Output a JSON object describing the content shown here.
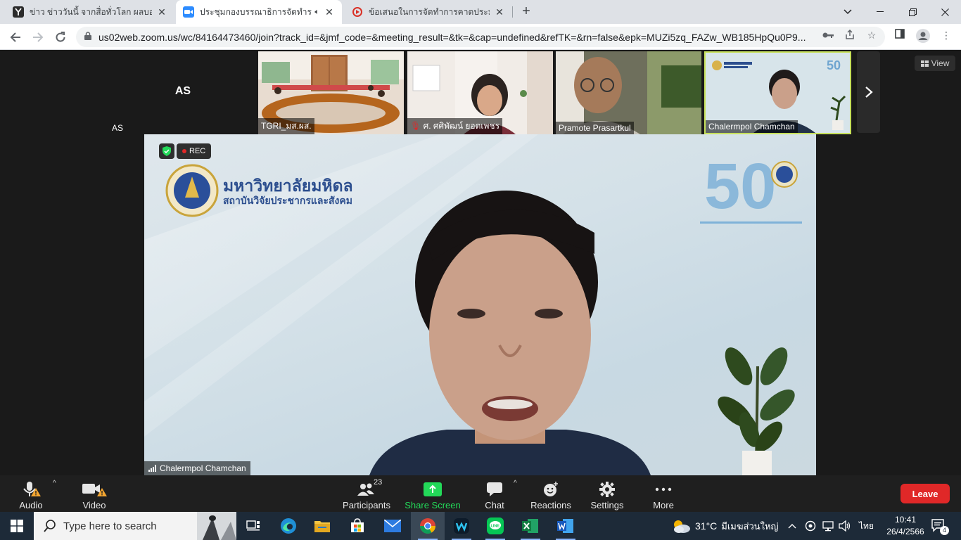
{
  "browser": {
    "tabs": [
      {
        "title": "ข่าว ข่าววันนี้ จากสื่อทั่วโลก ผลบอลโลก",
        "active": false
      },
      {
        "title": "ประชุมกองบรรณาธิการจัดทำราย",
        "active": true,
        "audio": true
      },
      {
        "title": "ข้อเสนอในการจัดทำการคาดประมาณป",
        "active": false
      }
    ],
    "url": "us02web.zoom.us/wc/84164473460/join?track_id=&jmf_code=&meeting_result=&tk=&cap=undefined&refTK=&rn=false&epk=MUZi5zq_FAZw_WB185HpQu0P9..."
  },
  "zoom": {
    "view_label": "View",
    "participants_strip": [
      {
        "name": "AS",
        "initials": "AS",
        "video": false
      },
      {
        "name": "TGRI_มส.ผส.",
        "video": true
      },
      {
        "name": "ศ. ศศิพัฒน์ ยอดเพชร",
        "video": true,
        "muted": true
      },
      {
        "name": "Pramote Prasartkul",
        "video": true
      },
      {
        "name": "Chalermpol Chamchan",
        "video": true,
        "speaking": true
      }
    ],
    "main_speaker": {
      "name": "Chalermpol Chamchan",
      "rec_label": "REC",
      "background_text": {
        "university": "มหาวิทยาลัยมหิดล",
        "institute": "สถาบันวิจัยประชากรและสังคม"
      }
    },
    "controls": {
      "audio": "Audio",
      "video": "Video",
      "participants": "Participants",
      "participants_count": "23",
      "share_screen": "Share Screen",
      "chat": "Chat",
      "reactions": "Reactions",
      "settings": "Settings",
      "more": "More",
      "leave": "Leave"
    }
  },
  "taskbar": {
    "search_placeholder": "Type here to search",
    "weather_temp": "31°C",
    "weather_text": "มีเมฆส่วนใหญ่",
    "language": "ไทย",
    "time": "10:41",
    "date": "26/4/2566",
    "notifications": "4"
  }
}
